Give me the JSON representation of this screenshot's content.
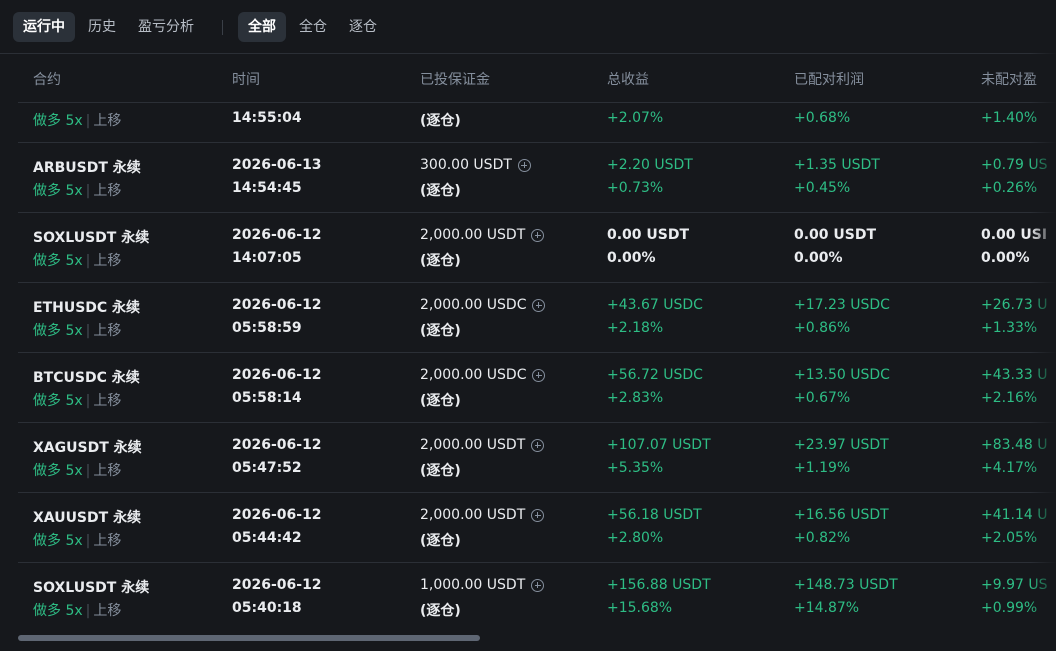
{
  "tabs": {
    "status": [
      {
        "label": "运行中",
        "active": true
      },
      {
        "label": "历史",
        "active": false
      },
      {
        "label": "盈亏分析",
        "active": false
      }
    ],
    "filter": [
      {
        "label": "全部",
        "active": true
      },
      {
        "label": "全仓",
        "active": false
      },
      {
        "label": "逐仓",
        "active": false
      }
    ]
  },
  "table": {
    "headers": [
      "合约",
      "时间",
      "已投保证金",
      "总收益",
      "已配对利润",
      "未配对盈"
    ],
    "rows": [
      {
        "symbol": "",
        "side": "做多",
        "leverage": "5x",
        "direction": "上移",
        "date": "",
        "time": "14:55:04",
        "margin": "",
        "mode": "(逐仓)",
        "total_amount": "",
        "total_pct": "+2.07%",
        "matched_amount": "",
        "matched_pct": "+0.68%",
        "unmatched_amount": "",
        "unmatched_pct": "+1.40%"
      },
      {
        "symbol": "ARBUSDT 永续",
        "side": "做多",
        "leverage": "5x",
        "direction": "上移",
        "date": "2026-06-13",
        "time": "14:54:45",
        "margin": "300.00 USDT",
        "mode": "(逐仓)",
        "total_amount": "+2.20 USDT",
        "total_pct": "+0.73%",
        "matched_amount": "+1.35 USDT",
        "matched_pct": "+0.45%",
        "unmatched_amount": "+0.79 US",
        "unmatched_pct": "+0.26%"
      },
      {
        "symbol": "SOXLUSDT 永续",
        "side": "做多",
        "leverage": "5x",
        "direction": "上移",
        "date": "2026-06-12",
        "time": "14:07:05",
        "margin": "2,000.00 USDT",
        "mode": "(逐仓)",
        "total_amount": "0.00 USDT",
        "total_pct": "0.00%",
        "matched_amount": "0.00 USDT",
        "matched_pct": "0.00%",
        "unmatched_amount": "0.00 USI",
        "unmatched_pct": "0.00%",
        "neutral": true
      },
      {
        "symbol": "ETHUSDC 永续",
        "side": "做多",
        "leverage": "5x",
        "direction": "上移",
        "date": "2026-06-12",
        "time": "05:58:59",
        "margin": "2,000.00 USDC",
        "mode": "(逐仓)",
        "total_amount": "+43.67 USDC",
        "total_pct": "+2.18%",
        "matched_amount": "+17.23 USDC",
        "matched_pct": "+0.86%",
        "unmatched_amount": "+26.73 U",
        "unmatched_pct": "+1.33%"
      },
      {
        "symbol": "BTCUSDC 永续",
        "side": "做多",
        "leverage": "5x",
        "direction": "上移",
        "date": "2026-06-12",
        "time": "05:58:14",
        "margin": "2,000.00 USDC",
        "mode": "(逐仓)",
        "total_amount": "+56.72 USDC",
        "total_pct": "+2.83%",
        "matched_amount": "+13.50 USDC",
        "matched_pct": "+0.67%",
        "unmatched_amount": "+43.33 U",
        "unmatched_pct": "+2.16%"
      },
      {
        "symbol": "XAGUSDT 永续",
        "side": "做多",
        "leverage": "5x",
        "direction": "上移",
        "date": "2026-06-12",
        "time": "05:47:52",
        "margin": "2,000.00 USDT",
        "mode": "(逐仓)",
        "total_amount": "+107.07 USDT",
        "total_pct": "+5.35%",
        "matched_amount": "+23.97 USDT",
        "matched_pct": "+1.19%",
        "unmatched_amount": "+83.48 U",
        "unmatched_pct": "+4.17%"
      },
      {
        "symbol": "XAUUSDT 永续",
        "side": "做多",
        "leverage": "5x",
        "direction": "上移",
        "date": "2026-06-12",
        "time": "05:44:42",
        "margin": "2,000.00 USDT",
        "mode": "(逐仓)",
        "total_amount": "+56.18 USDT",
        "total_pct": "+2.80%",
        "matched_amount": "+16.56 USDT",
        "matched_pct": "+0.82%",
        "unmatched_amount": "+41.14 U",
        "unmatched_pct": "+2.05%"
      },
      {
        "symbol": "SOXLUSDT 永续",
        "side": "做多",
        "leverage": "5x",
        "direction": "上移",
        "date": "2026-06-12",
        "time": "05:40:18",
        "margin": "1,000.00 USDT",
        "mode": "(逐仓)",
        "total_amount": "+156.88 USDT",
        "total_pct": "+15.68%",
        "matched_amount": "+148.73 USDT",
        "matched_pct": "+14.87%",
        "unmatched_amount": "+9.97 US",
        "unmatched_pct": "+0.99%"
      }
    ]
  },
  "colors": {
    "profit": "#2ebd85",
    "background": "#16181c",
    "muted": "#848e9c"
  },
  "icons": {
    "add_margin": "plus-circle-icon"
  }
}
